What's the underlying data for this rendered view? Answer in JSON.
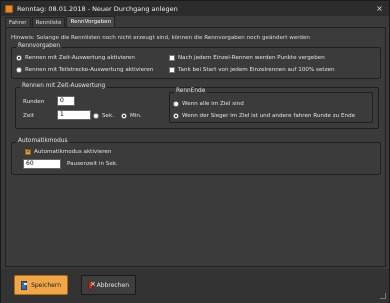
{
  "window": {
    "title": "Renntag: 08.01.2018 - Neuer Durchgang anlegen",
    "close_symbol": "×"
  },
  "tabs": [
    {
      "label": "Fahrer"
    },
    {
      "label": "Rennliste"
    },
    {
      "label": "RennVorgaben"
    }
  ],
  "hint": "Hinweis: Solange die Rennlisten noch nicht erzeugt sind, können die Rennvorgaben noch geändert werden",
  "rennvorgaben": {
    "legend": "Rennvorgaben",
    "options": [
      {
        "label": "Rennen mit Zeit-Auswertung aktivieren",
        "selected": true
      },
      {
        "label": "Rennen mit Teilstrecke-Auswertung aktivieren",
        "selected": false
      }
    ],
    "checks": [
      {
        "label": "Nach jedem Einzel-Rennen werden Punkte vergeben",
        "checked": false
      },
      {
        "label": "Tank bei Start von jedem Einzelrennen auf 100% setzen",
        "checked": false
      }
    ]
  },
  "zeitauswertung": {
    "legend": "Rennen mit Zeit-Auswertung",
    "runden_label": "Runden",
    "runden_value": "0",
    "zeit_label": "Zeit",
    "zeit_value": "1",
    "unit_sek": "Sek.",
    "unit_min": "Min.",
    "unit_selected": "Min."
  },
  "rennende": {
    "legend": "RennEnde",
    "options": [
      {
        "label": "Wenn alle im Ziel sind",
        "selected": false
      },
      {
        "label": "Wenn der Sieger im Ziel ist und andere fahren Runde zu Ende",
        "selected": true
      }
    ]
  },
  "automatikmodus": {
    "legend": "Automatikmodus",
    "check_label": "Automatikmodus aktivieren",
    "checked": true,
    "pause_value": "60",
    "pause_label": "Pausenzeit in Sek."
  },
  "buttons": {
    "save": "Speichern",
    "cancel": "Abbrechen"
  },
  "colors": {
    "accent": "#f1a64a",
    "background": "#3a3a3a"
  }
}
